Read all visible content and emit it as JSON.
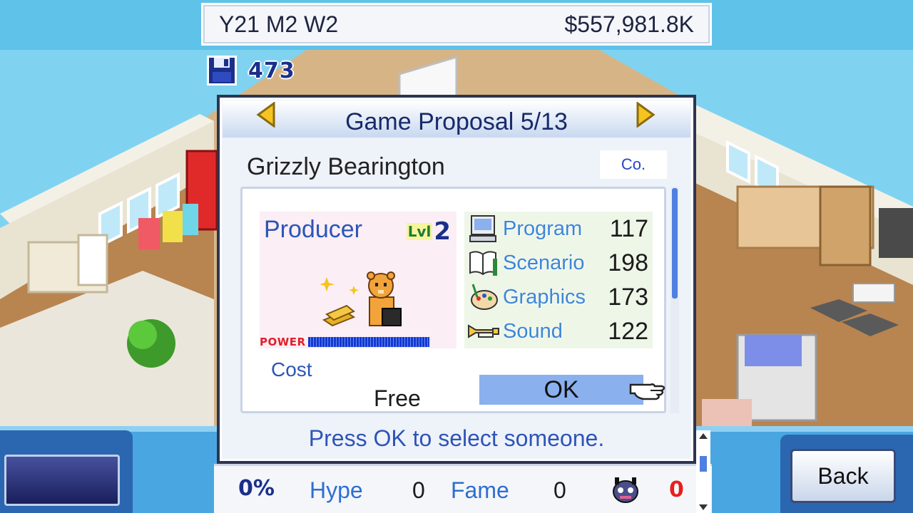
{
  "header": {
    "date": "Y21 M2 W2",
    "money": "$557,981.8K"
  },
  "saves": {
    "count": "473",
    "icon": "floppy-disk-icon"
  },
  "dialog": {
    "title": "Game Proposal 5/13",
    "prev_icon": "arrow-left-icon",
    "next_icon": "arrow-right-icon",
    "candidate_name": "Grizzly Bearington",
    "company_badge": "Co.",
    "role": "Producer",
    "level_tag": "Lvl",
    "level": "2",
    "power_label": "POWER",
    "power_fraction": 0.99,
    "stats": [
      {
        "label": "Program",
        "value": "117",
        "icon": "computer-icon"
      },
      {
        "label": "Scenario",
        "value": "198",
        "icon": "book-icon"
      },
      {
        "label": "Graphics",
        "value": "173",
        "icon": "palette-icon"
      },
      {
        "label": "Sound",
        "value": "122",
        "icon": "trumpet-icon"
      }
    ],
    "cost_label": "Cost",
    "cost_value": "Free",
    "ok_label": "OK",
    "hint": "Press OK to select someone."
  },
  "bottom": {
    "percent": "0%",
    "hype_label": "Hype",
    "hype_value": "0",
    "fame_label": "Fame",
    "fame_value": "0",
    "alert_count": "0",
    "back_label": "Back"
  },
  "colors": {
    "accent_blue": "#2d55b8",
    "panel_bg": "#eef2f9",
    "ok_button": "#8ab0ee",
    "alert_red": "#e81e1e"
  }
}
